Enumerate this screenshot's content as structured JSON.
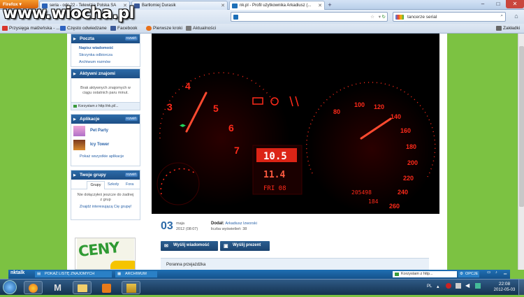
{
  "watermark": "www.wiocha.pl",
  "browser": {
    "menu_button": "Firefox",
    "tabs": [
      {
        "label": "seria - odc.22 - Telewizja Polska SA"
      },
      {
        "label": "Bartłomiej Durasik"
      },
      {
        "label": "nk.pl - Profil użytkownika Arkadiusz (...",
        "active": true
      }
    ],
    "new_tab": "+",
    "window_controls": [
      "–",
      "□",
      "✕"
    ],
    "url": "",
    "search_value": "tancerze serial",
    "bookmarks": [
      {
        "label": "Przysięga małżeńska - ...",
        "color": "#d9352b"
      },
      {
        "label": "Często odwiedzane",
        "color": "#2f63c0"
      },
      {
        "label": "Facebook",
        "color": "#3b5998"
      },
      {
        "label": "Pierwsze kroki",
        "color": "#e8701a"
      },
      {
        "label": "Aktualności",
        "color": "#7a7a7a"
      }
    ],
    "bookmarks_menu": "Zakładki"
  },
  "sidebar": {
    "poczta": {
      "title": "Poczta",
      "toggle": "rozwiń",
      "links": [
        "Napisz wiadomość",
        "Skrzynka odbiorcza",
        "Archiwum rozmów"
      ]
    },
    "znajomi": {
      "title": "Aktywni znajomi",
      "message": "Brak aktywnych znajomych w ciągu ostatnich paru minut.",
      "using": "Korzystam z http://nk.pl/..."
    },
    "aplikacje": {
      "title": "Aplikacje",
      "toggle": "rozwiń",
      "apps": [
        "Pet Party",
        "Icy Tower"
      ],
      "show_all": "Pokaż wszystkie aplikacje"
    },
    "grupy": {
      "title": "Twoje grupy",
      "toggle": "rozwiń",
      "tabs": [
        "Grupy",
        "Szkoły",
        "Fora"
      ],
      "message": "Nie dołączyłeś jeszcze do żadnej z grup",
      "find": "Znajdź interesującą Cię grupę!"
    },
    "ad_text": "CENY"
  },
  "dashboard": {
    "digital_top": "10.5",
    "digital_mid": "11.4",
    "digital_bottom": "FRI 08",
    "odometer": "205498",
    "trip": "184",
    "tach_numbers": [
      "3",
      "4",
      "5",
      "6",
      "7"
    ],
    "speedo_numbers": [
      "80",
      "100",
      "120",
      "140",
      "160",
      "180",
      "200",
      "220",
      "240",
      "260"
    ]
  },
  "post": {
    "day": "03",
    "month": "maja",
    "datetime": "2012 (08:07)",
    "added_label": "Dodał:",
    "author": "Arkadiusz Izworski",
    "views_label": "liczba wyświetleń:",
    "views": "38",
    "send_message": "Wyślij wiadomość",
    "send_gift": "Wyślij prezent",
    "caption": "Poranna przejażdżka"
  },
  "nktalk": {
    "logo": "nktalk",
    "show_friends": "POKAŻ LISTĘ ZNAJOMYCH",
    "archive": "ARCHIWUM",
    "status": "Korzystam z http...",
    "options": "OPCJE"
  },
  "taskbar": {
    "lang": "PL",
    "time": "22:08",
    "date": "2012-05-03",
    "apps": [
      "firefox",
      "gmail",
      "explorer",
      "media",
      "winamp"
    ]
  },
  "colors": {
    "page_bg": "#7cc242",
    "accent": "#1d4f86",
    "dash_red": "#ff2a1a"
  }
}
